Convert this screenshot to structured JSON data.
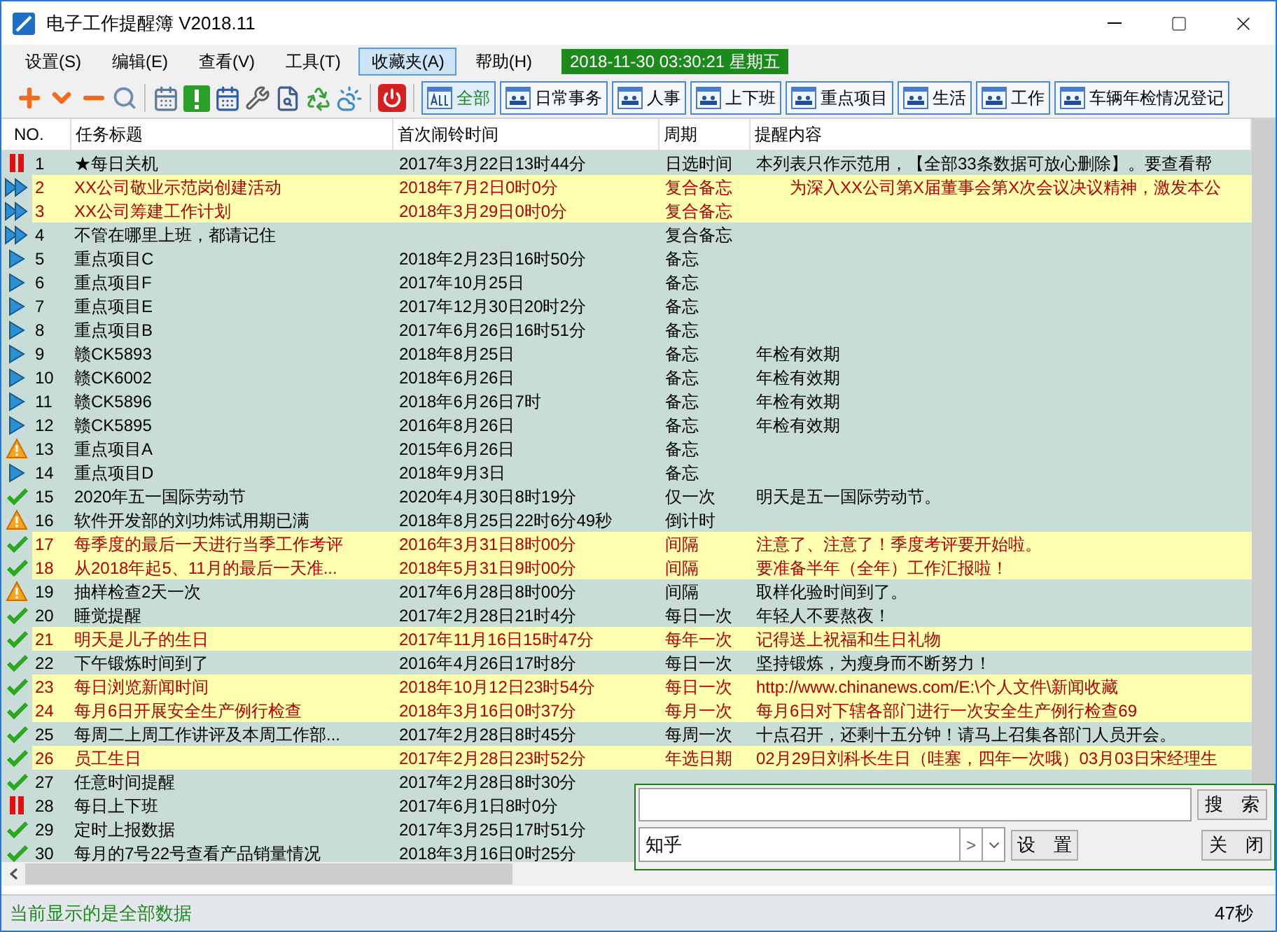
{
  "window": {
    "title": "电子工作提醒簿 V2018.11"
  },
  "menu": [
    {
      "label": "设置(S)",
      "selected": false
    },
    {
      "label": "编辑(E)",
      "selected": false
    },
    {
      "label": "查看(V)",
      "selected": false
    },
    {
      "label": "工具(T)",
      "selected": false
    },
    {
      "label": "收藏夹(A)",
      "selected": true
    },
    {
      "label": "帮助(H)",
      "selected": false
    }
  ],
  "clock": "2018-11-30 03:30:21 星期五",
  "categories": [
    {
      "label": "全部",
      "selected": true
    },
    {
      "label": "日常事务",
      "selected": false
    },
    {
      "label": "人事",
      "selected": false
    },
    {
      "label": "上下班",
      "selected": false
    },
    {
      "label": "重点项目",
      "selected": false
    },
    {
      "label": "生活",
      "selected": false
    },
    {
      "label": "工作",
      "selected": false
    },
    {
      "label": "车辆年检情况登记",
      "selected": false
    }
  ],
  "table": {
    "columns": [
      "NO.",
      "任务标题",
      "首次闹铃时间",
      "周期",
      "提醒内容"
    ],
    "rows": [
      {
        "kind": "paused",
        "highlighted": false,
        "no": "1",
        "title": "★每日关机",
        "time": "2017年3月22日13时44分",
        "period": "日选时间",
        "content": "本列表只作示范用，【全部33条数据可放心删除】。要查看帮"
      },
      {
        "kind": "running",
        "highlighted": true,
        "no": "2",
        "title": "XX公司敬业示范岗创建活动",
        "time": "2018年7月2日0时0分",
        "period": "复合备忘",
        "content": "　　为深入XX公司第X届董事会第X次会议决议精神，激发本公"
      },
      {
        "kind": "running",
        "highlighted": true,
        "no": "3",
        "title": "XX公司筹建工作计划",
        "time": "2018年3月29日0时0分",
        "period": "复合备忘"
      },
      {
        "kind": "running",
        "highlighted": false,
        "no": "4",
        "title": "不管在哪里上班，都请记住",
        "period": "复合备忘"
      },
      {
        "kind": "active",
        "highlighted": false,
        "no": "5",
        "title": "重点项目C",
        "time": "2018年2月23日16时50分",
        "period": "备忘"
      },
      {
        "kind": "active",
        "highlighted": false,
        "no": "6",
        "title": "重点项目F",
        "time": "2017年10月25日",
        "period": "备忘"
      },
      {
        "kind": "active",
        "highlighted": false,
        "no": "7",
        "title": "重点项目E",
        "time": "2017年12月30日20时2分",
        "period": "备忘"
      },
      {
        "kind": "active",
        "highlighted": false,
        "no": "8",
        "title": "重点项目B",
        "time": "2017年6月26日16时51分",
        "period": "备忘"
      },
      {
        "kind": "active",
        "highlighted": false,
        "no": "9",
        "title": "赣CK5893",
        "time": "2018年8月25日",
        "period": "备忘",
        "content": "年检有效期"
      },
      {
        "kind": "active",
        "highlighted": false,
        "no": "10",
        "title": "赣CK6002",
        "time": "2018年6月26日",
        "period": "备忘",
        "content": "年检有效期"
      },
      {
        "kind": "active",
        "highlighted": false,
        "no": "11",
        "title": "赣CK5896",
        "time": "2018年6月26日7时",
        "period": "备忘",
        "content": "年检有效期"
      },
      {
        "kind": "active",
        "highlighted": false,
        "no": "12",
        "title": "赣CK5895",
        "time": "2016年8月26日",
        "period": "备忘",
        "content": "年检有效期"
      },
      {
        "kind": "warning",
        "highlighted": false,
        "no": "13",
        "title": "重点项目A",
        "time": "2015年6月26日",
        "period": "备忘"
      },
      {
        "kind": "active",
        "highlighted": false,
        "no": "14",
        "title": "重点项目D",
        "time": "2018年9月3日",
        "period": "备忘"
      },
      {
        "kind": "done",
        "highlighted": false,
        "no": "15",
        "title": "2020年五一国际劳动节",
        "time": "2020年4月30日8时19分",
        "period": "仅一次",
        "content": "明天是五一国际劳动节。"
      },
      {
        "kind": "warning",
        "highlighted": false,
        "no": "16",
        "title": "软件开发部的刘功炜试用期已满",
        "time": "2018年8月25日22时6分49秒",
        "period": "倒计时"
      },
      {
        "kind": "done",
        "highlighted": true,
        "no": "17",
        "title": "每季度的最后一天进行当季工作考评",
        "time": "2016年3月31日8时00分",
        "period": "间隔",
        "content": "注意了、注意了！季度考评要开始啦。"
      },
      {
        "kind": "done",
        "highlighted": true,
        "no": "18",
        "title": "从2018年起5、11月的最后一天准...",
        "time": "2018年5月31日9时00分",
        "period": "间隔",
        "content": "要准备半年（全年）工作汇报啦！"
      },
      {
        "kind": "warning",
        "highlighted": false,
        "no": "19",
        "title": "抽样检查2天一次",
        "time": "2017年6月28日8时00分",
        "period": "间隔",
        "content": "取样化验时间到了。"
      },
      {
        "kind": "done",
        "highlighted": false,
        "no": "20",
        "title": "睡觉提醒",
        "time": "2017年2月28日21时4分",
        "period": "每日一次",
        "content": "年轻人不要熬夜！"
      },
      {
        "kind": "done",
        "highlighted": true,
        "no": "21",
        "title": "明天是儿子的生日",
        "time": "2017年11月16日15时47分",
        "period": "每年一次",
        "content": "记得送上祝福和生日礼物"
      },
      {
        "kind": "done",
        "highlighted": false,
        "no": "22",
        "title": "下午锻炼时间到了",
        "time": "2016年4月26日17时8分",
        "period": "每日一次",
        "content": "坚持锻炼，为瘦身而不断努力！"
      },
      {
        "kind": "done",
        "highlighted": true,
        "no": "23",
        "title": "每日浏览新闻时间",
        "time": "2018年10月12日23时54分",
        "period": "每日一次",
        "content": "http://www.chinanews.com/E:\\个人文件\\新闻收藏"
      },
      {
        "kind": "done",
        "highlighted": true,
        "no": "24",
        "title": "每月6日开展安全生产例行检查",
        "time": "2018年3月16日0时37分",
        "period": "每月一次",
        "content": "每月6日对下辖各部门进行一次安全生产例行检查69"
      },
      {
        "kind": "done",
        "highlighted": false,
        "no": "25",
        "title": "每周二上周工作讲评及本周工作部...",
        "time": "2017年2月28日8时45分",
        "period": "每周一次",
        "content": "十点召开，还剩十五分钟！请马上召集各部门人员开会。"
      },
      {
        "kind": "done",
        "highlighted": true,
        "no": "26",
        "title": "员工生日",
        "time": "2017年2月28日23时52分",
        "period": "年选日期",
        "content": "02月29日刘科长生日（哇塞，四年一次哦）03月03日宋经理生"
      },
      {
        "kind": "done",
        "highlighted": false,
        "no": "27",
        "title": "任意时间提醒",
        "time": "2017年2月28日8时30分"
      },
      {
        "kind": "paused",
        "highlighted": false,
        "no": "28",
        "title": "每日上下班",
        "time": "2017年6月1日8时0分"
      },
      {
        "kind": "done",
        "highlighted": false,
        "no": "29",
        "title": "定时上报数据",
        "time": "2017年3月25日17时51分"
      },
      {
        "kind": "done",
        "highlighted": false,
        "no": "30",
        "title": "每月的7号22号查看产品销量情况",
        "time": "2018年3月16日0时25分"
      }
    ]
  },
  "search_panel": {
    "search_button": "搜　索",
    "engine": "知乎",
    "prev_button": ">",
    "settings_button": "设　置",
    "close_button": "关　闭"
  },
  "status_bar": {
    "message": "当前显示的是全部数据",
    "timer": "47秒"
  }
}
